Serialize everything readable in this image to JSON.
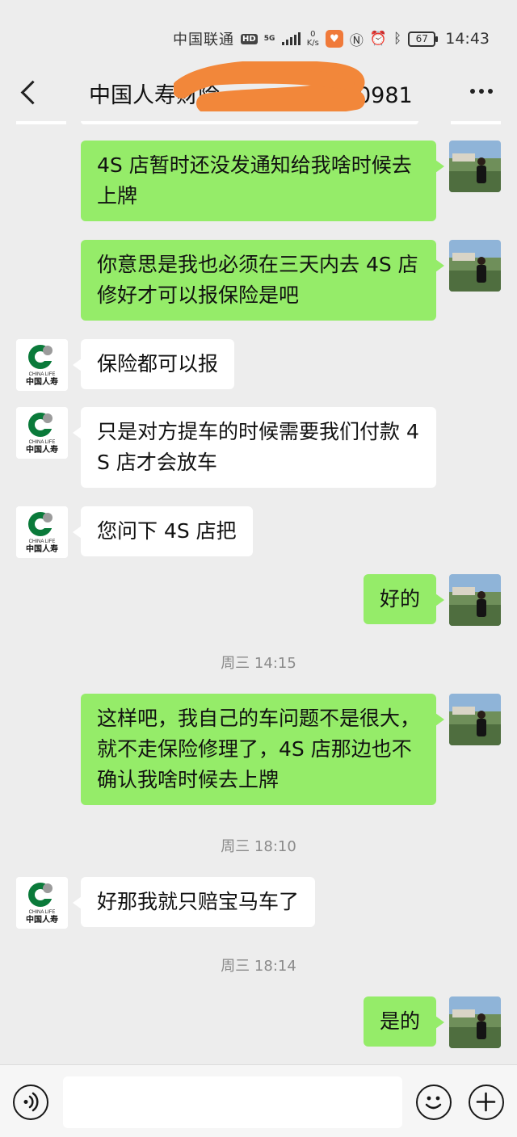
{
  "status_bar": {
    "carrier": "中国联通",
    "hd": "HD",
    "network": "5G",
    "speed_value": "0",
    "speed_unit": "K/s",
    "battery": "67",
    "time": "14:43"
  },
  "nav": {
    "title": "中国人寿财险",
    "title_tail": "0981"
  },
  "messages": [
    {
      "id": 1,
      "from": "me",
      "text": "4S 店暂时还没发通知给我啥时候去上牌"
    },
    {
      "id": 2,
      "from": "me",
      "text": "你意思是我也必须在三天内去 4S 店修好才可以报保险是吧"
    },
    {
      "id": 3,
      "from": "them",
      "text": "保险都可以报"
    },
    {
      "id": 4,
      "from": "them",
      "text": "只是对方提车的时候需要我们付款 4S 店才会放车"
    },
    {
      "id": 5,
      "from": "them",
      "text": "您问下 4S 店把"
    },
    {
      "id": 6,
      "from": "me",
      "text": "好的"
    },
    {
      "id": 7,
      "type": "time",
      "text": "周三 14:15"
    },
    {
      "id": 8,
      "from": "me",
      "text": "这样吧，我自己的车问题不是很大，就不走保险修理了，4S 店那边也不确认我啥时候去上牌"
    },
    {
      "id": 9,
      "type": "time",
      "text": "周三 18:10"
    },
    {
      "id": 10,
      "from": "them",
      "text": "好那我就只赔宝马车了"
    },
    {
      "id": 11,
      "type": "time",
      "text": "周三 18:14"
    },
    {
      "id": 12,
      "from": "me",
      "text": "是的"
    }
  ],
  "contact_avatar": {
    "logo_text_en": "CHINA LIFE",
    "logo_text_cn": "中国人寿",
    "brand_color": "#0a7a3a"
  },
  "colors": {
    "background": "#ededed",
    "my_bubble": "#95ec69",
    "their_bubble": "#ffffff",
    "redaction": "#f2873a"
  },
  "input": {
    "value": "",
    "placeholder": ""
  }
}
